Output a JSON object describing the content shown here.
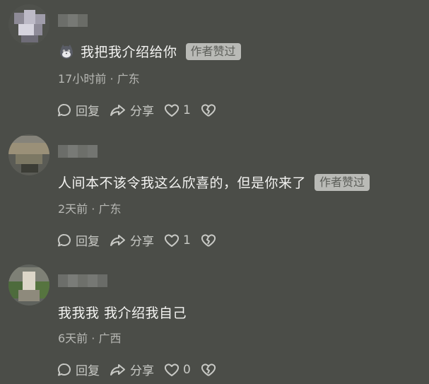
{
  "comments": [
    {
      "text": "我把我介绍给你",
      "badge": "作者赞过",
      "meta": "17小时前 · 广东",
      "reply_label": "回复",
      "share_label": "分享",
      "like_count": "1",
      "has_emoji": true,
      "emoji_icon": "cat-emoji-icon"
    },
    {
      "text": "人间本不该令我这么欣喜的，但是你来了",
      "badge": "作者赞过",
      "meta": "2天前 · 广东",
      "reply_label": "回复",
      "share_label": "分享",
      "like_count": "1"
    },
    {
      "text": "我我我 我介绍我自己",
      "meta": "6天前 · 广西",
      "reply_label": "回复",
      "share_label": "分享",
      "like_count": "0"
    }
  ],
  "colors": {
    "background": "#4b4d48",
    "text": "#f3f3f1",
    "meta": "#b7b8b4",
    "badge_bg": "#b9bab6",
    "badge_text": "#5b5d58"
  }
}
